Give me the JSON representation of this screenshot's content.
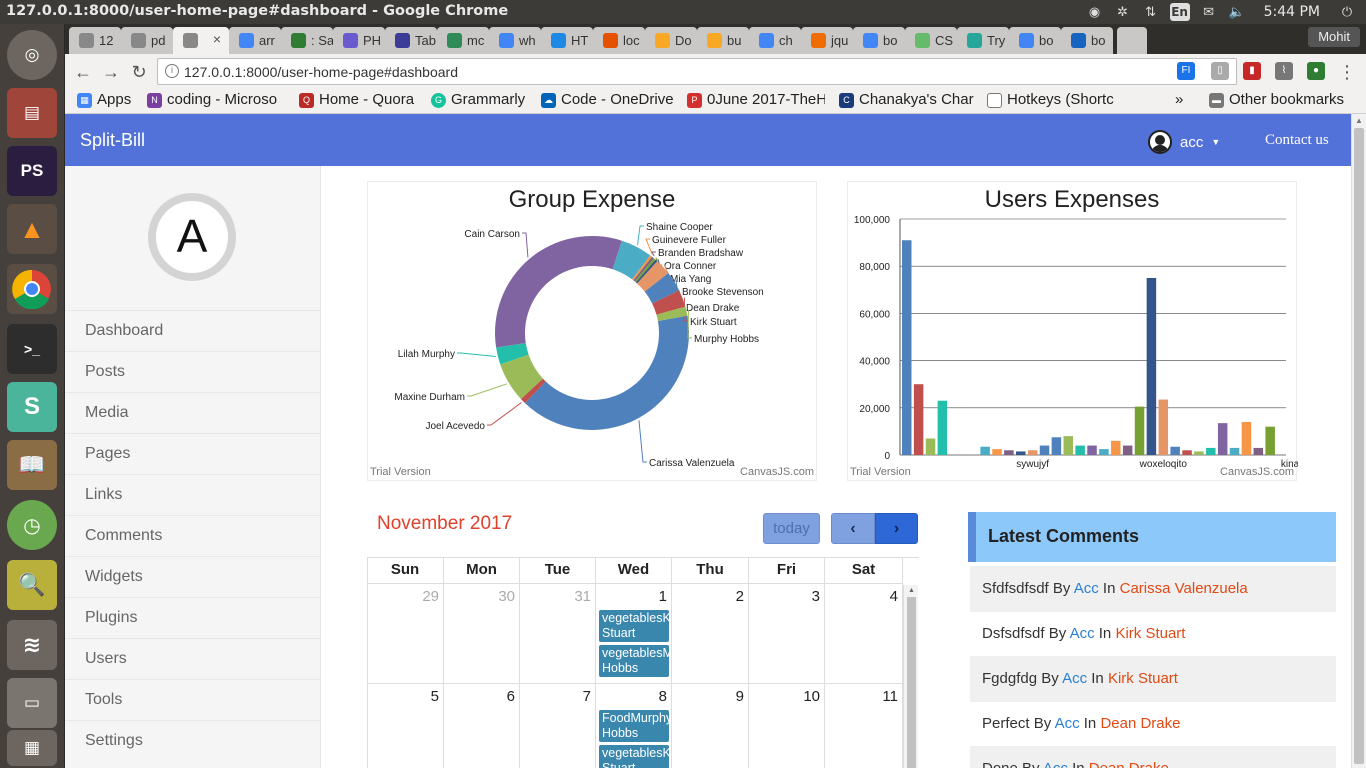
{
  "os": {
    "window_title": "127.0.0.1:8000/user-home-page#dashboard - Google Chrome",
    "lang": "En",
    "clock": "5:44 PM"
  },
  "chrome": {
    "tabs": [
      "12",
      "pd",
      "",
      "arr",
      ": Sa",
      "PH",
      "Tab",
      "mc",
      "wh",
      "HT",
      "loc",
      "Do",
      "bu",
      "ch",
      "jqu",
      "bo",
      "CS",
      "Try",
      "bo",
      "bo"
    ],
    "profile": "Mohit",
    "url": "127.0.0.1:8000/user-home-page#dashboard",
    "bookmarks": [
      "Apps",
      "coding - Microso",
      "Home - Quora",
      "Grammarly",
      "Code - OneDrive",
      "0June 2017-TheH",
      "Chanakya's Char",
      "Hotkeys (Shortc"
    ],
    "other_bookmarks": "Other bookmarks"
  },
  "app": {
    "brand": "Split-Bill",
    "user": "acc",
    "contact": "Contact us",
    "avatar_letter": "A",
    "sidebar": [
      "Dashboard",
      "Posts",
      "Media",
      "Pages",
      "Links",
      "Comments",
      "Widgets",
      "Plugins",
      "Users",
      "Tools",
      "Settings"
    ]
  },
  "chart_data": [
    {
      "type": "pie",
      "title": "Group Expense",
      "trial": "Trial Version",
      "credit": "CanvasJS.com",
      "labels": [
        "Carissa Valenzuela",
        "Joel Acevedo",
        "Maxine Durham",
        "Lilah Murphy",
        "Cain Carson",
        "Shaine Cooper",
        "Guinevere Fuller",
        "Branden Bradshaw",
        "Ora Conner",
        "Mia Yang",
        "Brooke Stevenson",
        "Dean Drake",
        "Kirk Stuart",
        "Murphy Hobbs"
      ],
      "values": [
        42,
        1,
        7,
        3,
        34,
        5.5,
        0.4,
        0.4,
        0.4,
        0.4,
        2.8,
        3.5,
        3,
        1.6
      ],
      "colors": [
        "#4f81bc",
        "#c0504e",
        "#9bbb58",
        "#23bfaa",
        "#8064a1",
        "#4aacc5",
        "#f79647",
        "#7f6084",
        "#77a033",
        "#33558b",
        "#e59566",
        "#4f81bc",
        "#c0504e",
        "#9bbb58"
      ]
    },
    {
      "type": "bar",
      "title": "Users Expenses",
      "trial": "Trial Version",
      "credit": "CanvasJS.com",
      "ylim": [
        0,
        100000
      ],
      "yticks": [
        "0",
        "20,000",
        "40,000",
        "60,000",
        "80,000",
        "100,000"
      ],
      "tick_labels": [
        {
          "label": "sywujyf",
          "at": 9
        },
        {
          "label": "woxeloqito",
          "at": 20
        },
        {
          "label": "kinaju",
          "at": 31
        }
      ],
      "values": [
        91000,
        30000,
        7000,
        23000,
        0,
        3500,
        2500,
        2000,
        1500,
        2000,
        4000,
        7500,
        8000,
        4000,
        4000,
        2500,
        6000,
        4000,
        20500,
        75000,
        23500,
        3500,
        2000,
        1500,
        3000,
        13500,
        3000,
        14000,
        3000,
        12000
      ],
      "colors": [
        "#4f81bc",
        "#c0504e",
        "#9bbb58",
        "#23bfaa",
        "#8064a1",
        "#4aacc5",
        "#f79647",
        "#7f6084",
        "#33558b",
        "#e59566",
        "#4f81bc",
        "#4f81bc",
        "#9bbb58",
        "#23bfaa",
        "#8064a1",
        "#4aacc5",
        "#f79647",
        "#7f6084",
        "#77a033",
        "#33558b",
        "#e59566",
        "#4f81bc",
        "#c0504e",
        "#9bbb58",
        "#23bfaa",
        "#8064a1",
        "#4aacc5",
        "#f79647",
        "#7f6084",
        "#77a033"
      ]
    }
  ],
  "calendar": {
    "title": "November 2017",
    "today": "today",
    "prev": "‹",
    "next": "›",
    "days": [
      "Sun",
      "Mon",
      "Tue",
      "Wed",
      "Thu",
      "Fri",
      "Sat"
    ],
    "week1": [
      "29",
      "30",
      "31",
      "1",
      "2",
      "3",
      "4"
    ],
    "week2": [
      "5",
      "6",
      "7",
      "8",
      "9",
      "10",
      "11"
    ],
    "events": [
      {
        "text": "vegetablesKirk Stuart",
        "day": 3,
        "week": 0,
        "slot": 0
      },
      {
        "text": "vegetablesMurphy Hobbs",
        "day": 3,
        "week": 0,
        "slot": 1
      },
      {
        "text": "FoodMurphy Hobbs",
        "day": 3,
        "week": 1,
        "slot": 0
      },
      {
        "text": "vegetablesKirk Stuart",
        "day": 3,
        "week": 1,
        "slot": 1
      }
    ]
  },
  "comments": {
    "title": "Latest Comments",
    "by_word": "By",
    "in_word": "In",
    "items": [
      {
        "text": "Sfdfsdfsdf",
        "by": "Acc",
        "in": "Carissa Valenzuela"
      },
      {
        "text": "Dsfsdfsdf",
        "by": "Acc",
        "in": "Kirk Stuart"
      },
      {
        "text": "Fgdgfdg",
        "by": "Acc",
        "in": "Kirk Stuart"
      },
      {
        "text": "Perfect",
        "by": "Acc",
        "in": "Dean Drake"
      },
      {
        "text": "Done",
        "by": "Acc",
        "in": "Dean Drake"
      }
    ]
  }
}
